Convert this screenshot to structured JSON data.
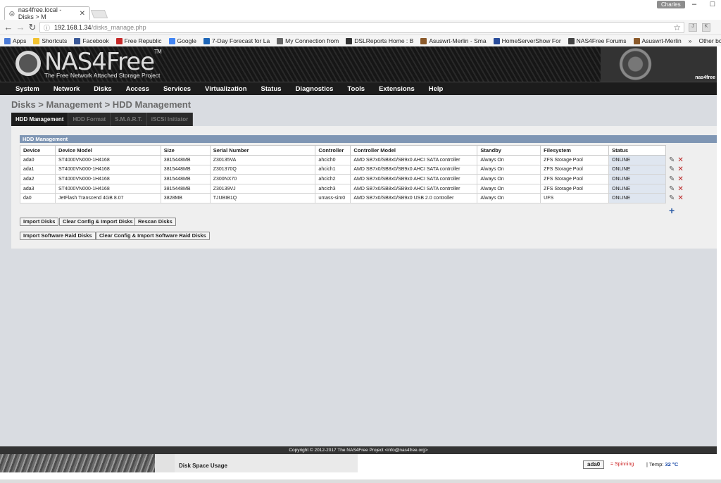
{
  "browser": {
    "tab_title": "nas4free.local - Disks > M",
    "tab_close": "✕",
    "user_badge": "Charles",
    "url_host": "192.168.1.34",
    "url_path": "/disks_manage.php",
    "bookmarks": [
      {
        "label": "Apps",
        "color": "#4a7ad6"
      },
      {
        "label": "Shortcuts",
        "color": "#f2c230"
      },
      {
        "label": "Facebook",
        "color": "#3b5998"
      },
      {
        "label": "Free Republic",
        "color": "#c62828"
      },
      {
        "label": "Google",
        "color": "#4285f4"
      },
      {
        "label": "7-Day Forecast for La",
        "color": "#1e66b8"
      },
      {
        "label": "My Connection from",
        "color": "#666666"
      },
      {
        "label": "DSLReports Home : B",
        "color": "#333333"
      },
      {
        "label": "Asuswrt-Merlin - Sma",
        "color": "#8b5a2b"
      },
      {
        "label": "HomeServerShow For",
        "color": "#2a4d9b"
      },
      {
        "label": "NAS4Free Forums",
        "color": "#444444"
      },
      {
        "label": "Asuswrt-Merlin",
        "color": "#8b5a2b"
      }
    ],
    "more": "»",
    "other_bookmarks": "Other bo"
  },
  "header": {
    "logo_text": "NAS4Free",
    "tm": "TM",
    "tagline": "The Free Network Attached Storage Project",
    "hdd_label": "nas4free"
  },
  "menu": [
    "System",
    "Network",
    "Disks",
    "Access",
    "Services",
    "Virtualization",
    "Status",
    "Diagnostics",
    "Tools",
    "Extensions",
    "Help"
  ],
  "breadcrumb": "Disks > Management > HDD Management",
  "subtabs": [
    "HDD Management",
    "HDD Format",
    "S.M.A.R.T.",
    "iSCSI Initiator"
  ],
  "panel_title": "HDD Management",
  "table": {
    "headers": [
      "Device",
      "Device Model",
      "Size",
      "Serial Number",
      "Controller",
      "Controller Model",
      "Standby",
      "Filesystem",
      "Status"
    ],
    "rows": [
      [
        "ada0",
        "ST4000VN000-1H4168",
        "3815448MB",
        "Z30135VA",
        "ahcich0",
        "AMD SB7x0/SB8x0/SB9x0 AHCI SATA controller",
        "Always On",
        "ZFS Storage Pool",
        "ONLINE"
      ],
      [
        "ada1",
        "ST4000VN000-1H4168",
        "3815448MB",
        "Z301370Q",
        "ahcich1",
        "AMD SB7x0/SB8x0/SB9x0 AHCI SATA controller",
        "Always On",
        "ZFS Storage Pool",
        "ONLINE"
      ],
      [
        "ada2",
        "ST4000VN000-1H4168",
        "3815448MB",
        "Z300NX70",
        "ahcich2",
        "AMD SB7x0/SB8x0/SB9x0 AHCI SATA controller",
        "Always On",
        "ZFS Storage Pool",
        "ONLINE"
      ],
      [
        "ada3",
        "ST4000VN000-1H4168",
        "3815448MB",
        "Z30139VJ",
        "ahcich3",
        "AMD SB7x0/SB8x0/SB9x0 AHCI SATA controller",
        "Always On",
        "ZFS Storage Pool",
        "ONLINE"
      ],
      [
        "da0",
        "JetFlash Transcend 4GB 8.07",
        "3828MB",
        "TJUBIB1Q",
        "umass-sim0",
        "AMD SB7x0/SB8x0/SB9x0 USB 2.0 controller",
        "Always On",
        "UFS",
        "ONLINE"
      ]
    ]
  },
  "buttons": {
    "import_disks": "Import Disks",
    "clear_import": "Clear Config & Import Disks",
    "rescan": "Rescan Disks",
    "import_raid": "Import Software Raid Disks",
    "clear_import_raid": "Clear Config & Import Software Raid Disks"
  },
  "footer": "Copyright © 2012-2017 The NAS4Free Project <info@nas4free.org>",
  "statusbar": {
    "disk_space": "Disk Space Usage",
    "disk": "ada0",
    "spinning": "= Spinning",
    "temp_label": "| Temp:",
    "temp_value": "32 °C"
  }
}
